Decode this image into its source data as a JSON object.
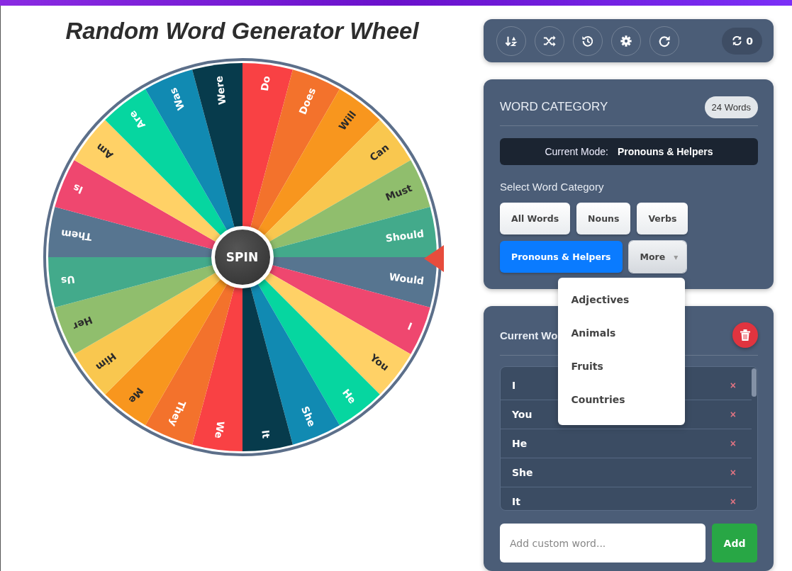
{
  "title": "Random Word Generator Wheel",
  "wheel": {
    "spin_label": "SPIN",
    "segments": [
      {
        "label": "Do",
        "color": "#f94144"
      },
      {
        "label": "Does",
        "color": "#f3722c"
      },
      {
        "label": "Will",
        "color": "#f8961e"
      },
      {
        "label": "Can",
        "color": "#f9c74f"
      },
      {
        "label": "Must",
        "color": "#90be6d"
      },
      {
        "label": "Should",
        "color": "#43aa8b"
      },
      {
        "label": "Would",
        "color": "#577590"
      },
      {
        "label": "I",
        "color": "#ef476f"
      },
      {
        "label": "You",
        "color": "#ffd166"
      },
      {
        "label": "He",
        "color": "#06d6a0"
      },
      {
        "label": "She",
        "color": "#118ab2"
      },
      {
        "label": "It",
        "color": "#073b4c"
      },
      {
        "label": "We",
        "color": "#f94144"
      },
      {
        "label": "They",
        "color": "#f3722c"
      },
      {
        "label": "Me",
        "color": "#f8961e"
      },
      {
        "label": "Him",
        "color": "#f9c74f"
      },
      {
        "label": "Her",
        "color": "#90be6d"
      },
      {
        "label": "Us",
        "color": "#43aa8b"
      },
      {
        "label": "Them",
        "color": "#577590"
      },
      {
        "label": "Is",
        "color": "#ef476f"
      },
      {
        "label": "Am",
        "color": "#ffd166"
      },
      {
        "label": "Are",
        "color": "#06d6a0"
      },
      {
        "label": "Was",
        "color": "#118ab2"
      },
      {
        "label": "Were",
        "color": "#073b4c"
      }
    ]
  },
  "toolbar": {
    "buttons": [
      {
        "kind": "sort"
      },
      {
        "kind": "shuffle"
      },
      {
        "kind": "history"
      },
      {
        "kind": "settings"
      },
      {
        "kind": "redo"
      }
    ],
    "spin_count": "0"
  },
  "category_panel": {
    "title": "WORD CATEGORY",
    "word_count": "24 Words",
    "mode_label": "Current Mode:",
    "mode_value": "Pronouns & Helpers",
    "section_label": "Select Word Category",
    "categories": [
      {
        "label": "All Words",
        "selected": false
      },
      {
        "label": "Nouns",
        "selected": false
      },
      {
        "label": "Verbs",
        "selected": false
      },
      {
        "label": "Pronouns & Helpers",
        "selected": true
      }
    ],
    "more": {
      "label": "More",
      "caret": "▾",
      "expanded": true,
      "options": [
        "Adjectives",
        "Animals",
        "Fruits",
        "Countries"
      ]
    }
  },
  "words_panel": {
    "title": "Current Wo",
    "words": [
      {
        "label": "I",
        "remove": "×"
      },
      {
        "label": "You",
        "remove": "×"
      },
      {
        "label": "He",
        "remove": "×"
      },
      {
        "label": "She",
        "remove": "×"
      },
      {
        "label": "It",
        "remove": "×"
      }
    ],
    "input": {
      "placeholder": "Add custom word..."
    },
    "add_button": "Add"
  }
}
